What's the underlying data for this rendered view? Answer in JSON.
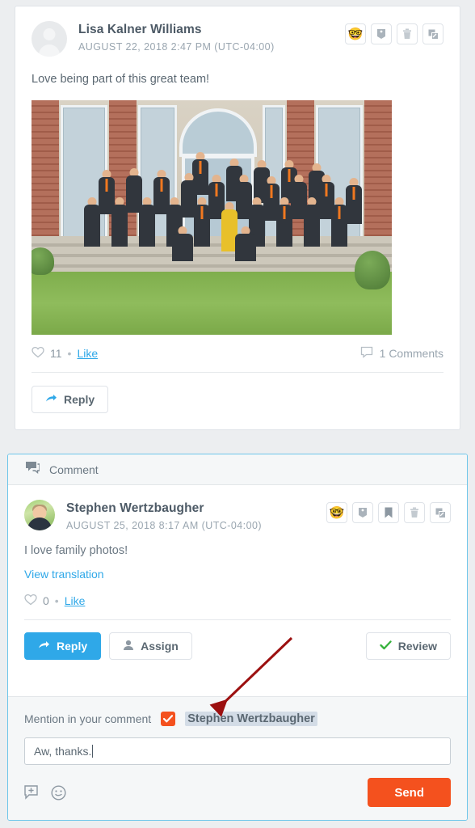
{
  "post": {
    "author": "Lisa Kalner Williams",
    "timestamp": "AUGUST 22, 2018 2:47 PM (UTC-04:00)",
    "text": "Love being part of this great team!",
    "avatar_type": "placeholder-avatar",
    "photo_alt": "Group team photo on stone steps in front of a chateau",
    "icons": [
      {
        "name": "emoji-icon",
        "glyph": "🤓"
      },
      {
        "name": "tag-icon"
      },
      {
        "name": "trash-icon"
      },
      {
        "name": "expand-icon"
      }
    ],
    "like_count": "11",
    "separator": "•",
    "like_label": "Like",
    "comments_count": "1 Comments",
    "reply_label": "Reply"
  },
  "comment_panel": {
    "header_label": "Comment",
    "author": "Stephen Wertzbaugher",
    "timestamp": "AUGUST 25, 2018 8:17 AM (UTC-04:00)",
    "text": "I love family photos!",
    "translate_label": "View translation",
    "like_count": "0",
    "separator": "•",
    "like_label": "Like",
    "icons": [
      {
        "name": "emoji-icon",
        "glyph": "🤓"
      },
      {
        "name": "tag-icon"
      },
      {
        "name": "bookmark-icon"
      },
      {
        "name": "trash-icon"
      },
      {
        "name": "expand-icon"
      }
    ],
    "actions": {
      "reply_label": "Reply",
      "assign_label": "Assign",
      "review_label": "Review"
    }
  },
  "composer": {
    "mention_label": "Mention in your comment",
    "mention_name": "Stephen Wertzbaugher",
    "mention_checked": true,
    "input_value": "Aw, thanks.",
    "input_placeholder": "",
    "send_label": "Send",
    "tools": [
      {
        "name": "add-comment-icon"
      },
      {
        "name": "emoji-picker-icon"
      }
    ]
  },
  "colors": {
    "accent_blue": "#2fa8e8",
    "accent_orange": "#f4511e",
    "panel_border": "#6ec6ea",
    "text_primary": "#5b6872",
    "text_muted": "#9aa6b0",
    "annotation_arrow": "#9c1010",
    "review_check": "#35b23b"
  }
}
